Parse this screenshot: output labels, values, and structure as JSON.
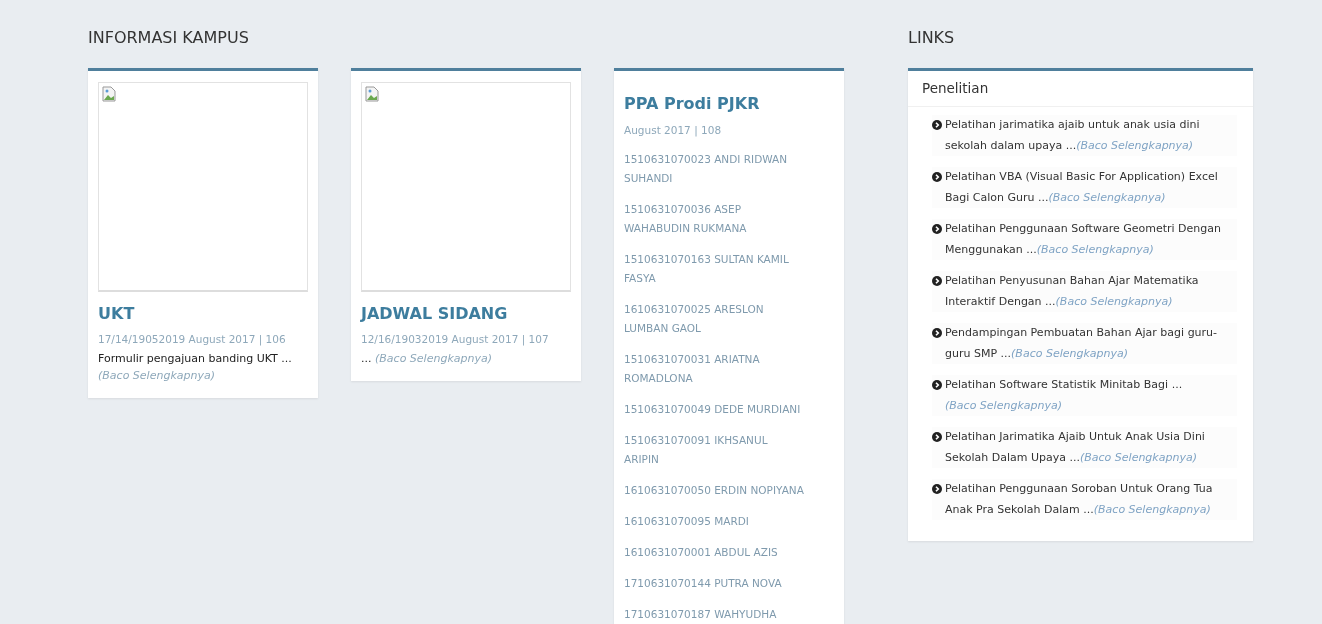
{
  "informasi_kampus": {
    "heading": "INFORMASI KAMPUS",
    "cards": [
      {
        "kind": "post",
        "title": "UKT",
        "meta": "17/14/19052019 August 2017 | 106",
        "excerpt": "Formulir pengajuan banding UKT ...",
        "more": "(Baco Selengkapnya)"
      },
      {
        "kind": "post",
        "title": "JADWAL SIDANG",
        "meta": "12/16/19032019 August 2017 | 107",
        "excerpt": "...",
        "more": "(Baco Selengkapnya)"
      },
      {
        "kind": "list",
        "title": "PPA Prodi PJKR",
        "meta": "August 2017 | 108",
        "items": [
          "1510631070023 ANDI RIDWAN SUHANDI",
          "1510631070036 ASEP WAHABUDIN RUKMANA",
          "1510631070163 SULTAN KAMIL FASYA",
          "1610631070025 ARESLON LUMBAN GAOL",
          "1510631070031 ARIATNA ROMADLONA",
          "1510631070049 DEDE MURDIANI",
          "1510631070091 IKHSANUL ARIPIN",
          "1610631070050 ERDIN NOPIYANA",
          "1610631070095 MARDI",
          "1610631070001 ABDUL AZIS",
          "1710631070144 PUTRA NOVA",
          "1710631070187 WAHYUDHA"
        ]
      }
    ]
  },
  "links": {
    "heading": "LINKS",
    "panel_title": "Penelitian",
    "items": [
      {
        "text": "Pelatihan jarimatika ajaib untuk anak usia dini sekolah dalam upaya ...",
        "more": "(Baco Selengkapnya)"
      },
      {
        "text": "Pelatihan VBA (Visual Basic For Application) Excel Bagi Calon Guru ...",
        "more": "(Baco Selengkapnya)"
      },
      {
        "text": "Pelatihan Penggunaan Software Geometri Dengan Menggunakan ...",
        "more": "(Baco Selengkapnya)"
      },
      {
        "text": "Pelatihan Penyusunan Bahan Ajar Matematika Interaktif Dengan ...",
        "more": "(Baco Selengkapnya)"
      },
      {
        "text": "Pendampingan Pembuatan Bahan Ajar bagi guru-guru SMP ...",
        "more": "(Baco Selengkapnya)"
      },
      {
        "text": "Pelatihan Software Statistik Minitab Bagi ...",
        "more": "(Baco Selengkapnya)"
      },
      {
        "text": "Pelatihan Jarimatika Ajaib Untuk Anak Usia Dini Sekolah Dalam Upaya ...",
        "more": "(Baco Selengkapnya)"
      },
      {
        "text": "Pelatihan Penggunaan Soroban Untuk Orang Tua Anak Pra Sekolah Dalam ...",
        "more": "(Baco Selengkapnya)"
      }
    ]
  }
}
